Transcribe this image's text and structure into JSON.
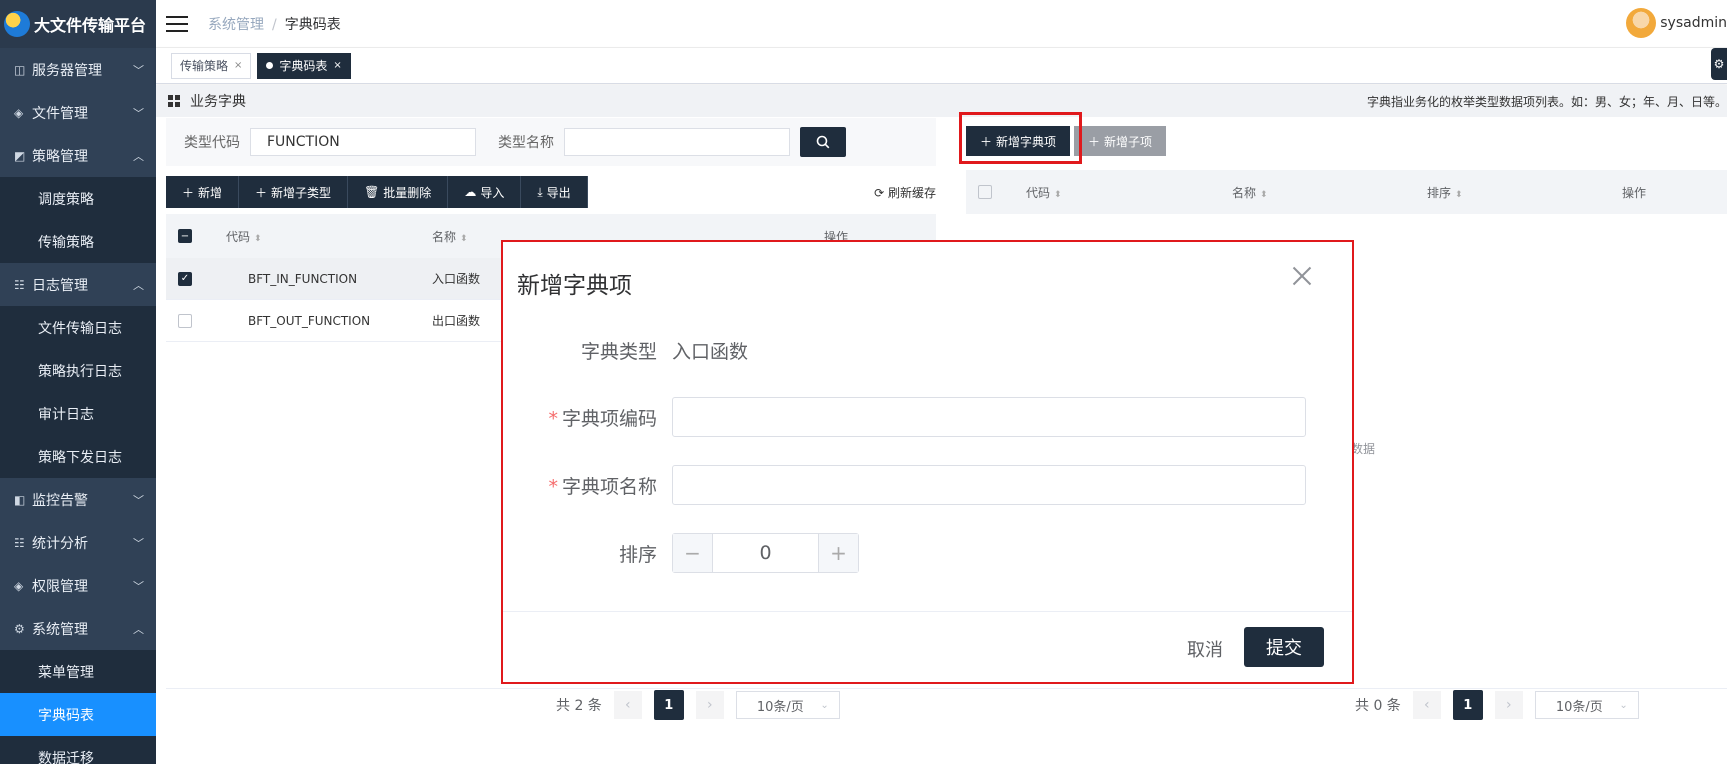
{
  "app": {
    "title": "大文件传输平台"
  },
  "sidebar": {
    "items": [
      {
        "label": "服务器管理",
        "icon": "server-icon",
        "expanded": false
      },
      {
        "label": "文件管理",
        "icon": "folder-icon",
        "expanded": false
      },
      {
        "label": "策略管理",
        "icon": "policy-icon",
        "expanded": true
      },
      {
        "label": "调度策略",
        "sub": true
      },
      {
        "label": "传输策略",
        "sub": true
      },
      {
        "label": "日志管理",
        "icon": "log-icon",
        "expanded": true
      },
      {
        "label": "文件传输日志",
        "sub": true
      },
      {
        "label": "策略执行日志",
        "sub": true
      },
      {
        "label": "审计日志",
        "sub": true
      },
      {
        "label": "策略下发日志",
        "sub": true
      },
      {
        "label": "监控告警",
        "icon": "monitor-icon",
        "expanded": false
      },
      {
        "label": "统计分析",
        "icon": "chart-icon",
        "expanded": false
      },
      {
        "label": "权限管理",
        "icon": "lock-icon",
        "expanded": false
      },
      {
        "label": "系统管理",
        "icon": "gear-icon",
        "expanded": true
      },
      {
        "label": "菜单管理",
        "sub": true
      },
      {
        "label": "字典码表",
        "sub": true,
        "active": true
      },
      {
        "label": "数据迁移",
        "sub": true
      }
    ]
  },
  "header": {
    "breadcrumb": [
      "系统管理",
      "/",
      "字典码表"
    ],
    "username": "sysadmin"
  },
  "tabs": [
    {
      "label": "传输策略",
      "close": "×",
      "active": false
    },
    {
      "label": "字典码表",
      "close": "×",
      "active": true
    }
  ],
  "section": {
    "title": "业务字典",
    "hint": "字典指业务化的枚举类型数据项列表。如：男、女；年、月、日等。"
  },
  "search": {
    "type_code_label": "类型代码",
    "type_code_value": "FUNCTION",
    "type_name_label": "类型名称",
    "type_name_value": ""
  },
  "toolbar": {
    "add": "新增",
    "add_sub_type": "新增子类型",
    "batch_delete": "批量删除",
    "import": "导入",
    "export": "导出",
    "refresh": "刷新缓存"
  },
  "left_table": {
    "columns": [
      "代码",
      "名称",
      "操作"
    ],
    "rows": [
      {
        "code": "BFT_IN_FUNCTION",
        "name": "入口函数",
        "selected": true
      },
      {
        "code": "BFT_OUT_FUNCTION",
        "name": "出口函数",
        "selected": false
      }
    ]
  },
  "right_panel": {
    "add_item": "新增字典项",
    "add_sub_item": "新增子项",
    "columns": [
      "代码",
      "名称",
      "排序",
      "操作"
    ],
    "empty_text": "数据"
  },
  "left_pager": {
    "total": "共 2 条",
    "page": "1",
    "size": "10条/页"
  },
  "right_pager": {
    "total": "共 0 条",
    "page": "1",
    "size": "10条/页"
  },
  "dialog": {
    "title": "新增字典项",
    "type_label": "字典类型",
    "type_value": "入口函数",
    "code_label": "字典项编码",
    "name_label": "字典项名称",
    "order_label": "排序",
    "order_value": "0",
    "required_mark": "*",
    "cancel": "取消",
    "submit": "提交"
  },
  "colors": {
    "primary": "#1f2d3d",
    "sidebar": "#304156",
    "active": "#1890ff",
    "highlight": "#e0191c"
  }
}
